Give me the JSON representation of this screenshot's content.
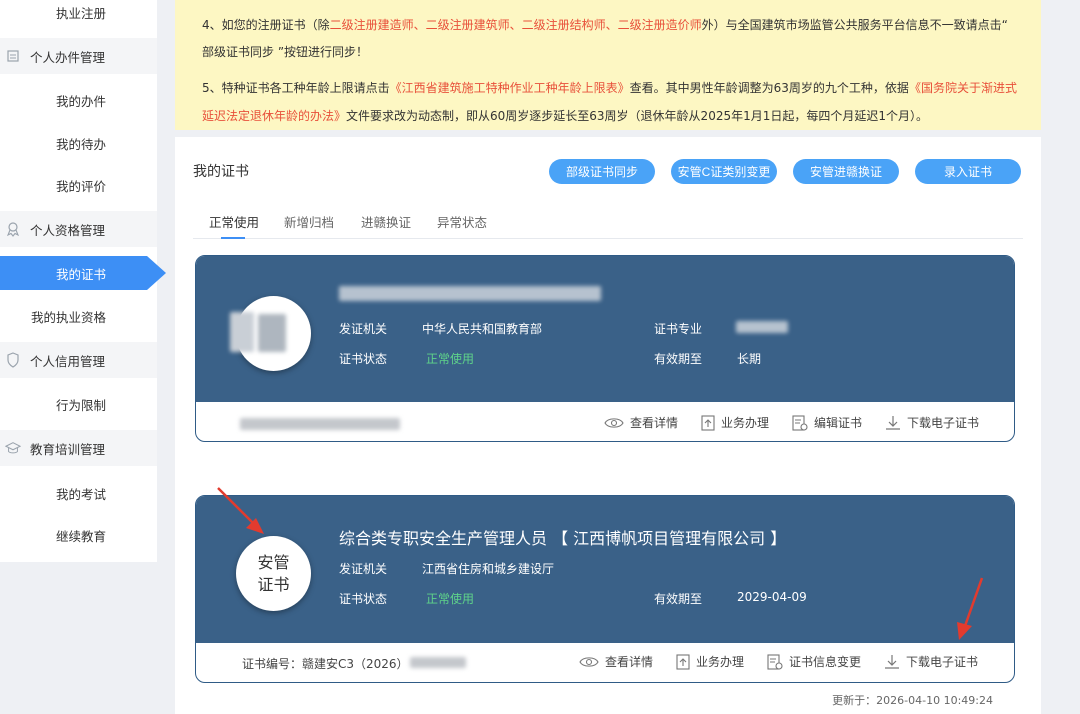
{
  "sidebar": {
    "top_item": "执业注册",
    "groups": [
      {
        "label": "个人办件管理",
        "icon": "document-icon",
        "items": [
          "我的办件",
          "我的待办",
          "我的评价"
        ]
      },
      {
        "label": "个人资格管理",
        "icon": "award-icon",
        "items": [
          "我的证书",
          "我的执业资格"
        ]
      },
      {
        "label": "个人信用管理",
        "icon": "shield-icon",
        "items": [
          "行为限制"
        ]
      },
      {
        "label": "教育培训管理",
        "icon": "graduation-cap-icon",
        "items": [
          "我的考试",
          "继续教育"
        ]
      }
    ],
    "active_item": "我的证书"
  },
  "notice": {
    "p4_a": "4、如您的注册证书（除",
    "p4_red": "二级注册建造师、二级注册建筑师、二级注册结构师、二级注册造价师",
    "p4_b": "外）与全国建筑市场监管公共服务平台信息不一致请点击“",
    "p4_c": "部级证书同步 ”按钮进行同步！",
    "p5_a": "5、特种证书各工种年龄上限请点击",
    "p5_red1": "《江西省建筑施工特种作业工种年龄上限表》",
    "p5_b": "查看。其中男性年龄调整为63周岁的九个工种，依据",
    "p5_red2": "《国务院关于渐进式延迟法定退休年龄的办法》",
    "p5_c": "文件要求改为动态制，即从60周岁逐步延长至63周岁（退休年龄从2025年1月1日起，每四个月延迟1个月）。"
  },
  "panel": {
    "title": "我的证书",
    "buttons": [
      "部级证书同步",
      "安管C证类别变更",
      "安管进赣换证",
      "录入证书"
    ],
    "tabs": [
      "正常使用",
      "新增归档",
      "进赣换证",
      "异常状态"
    ],
    "active_tab": "正常使用"
  },
  "cards": [
    {
      "fields": {
        "issuer_label": "发证机关",
        "issuer": "中华人民共和国教育部",
        "status_label": "证书状态",
        "status": "正常使用",
        "major_label": "证书专业",
        "validity_label": "有效期至",
        "validity": "长期"
      },
      "actions": [
        "查看详情",
        "业务办理",
        "编辑证书",
        "下载电子证书"
      ]
    },
    {
      "badge": "安管证书",
      "title": "综合类专职安全生产管理人员 【 江西博帆项目管理有限公司 】",
      "fields": {
        "issuer_label": "发证机关",
        "issuer": "江西省住房和城乡建设厅",
        "status_label": "证书状态",
        "status": "正常使用",
        "validity_label": "有效期至",
        "validity": "2029-04-09"
      },
      "cert_no": "证书编号：赣建安C3（2026）",
      "actions": [
        "查看详情",
        "业务办理",
        "证书信息变更",
        "下载电子证书"
      ]
    }
  ],
  "updated": "更新于：2026-04-10 10:49:24",
  "colors": {
    "accent": "#3d8ff5",
    "card": "#3a6188",
    "status_green": "#5fd38a",
    "notice_bg": "#fdf7c3",
    "link_red": "#e8503a"
  }
}
